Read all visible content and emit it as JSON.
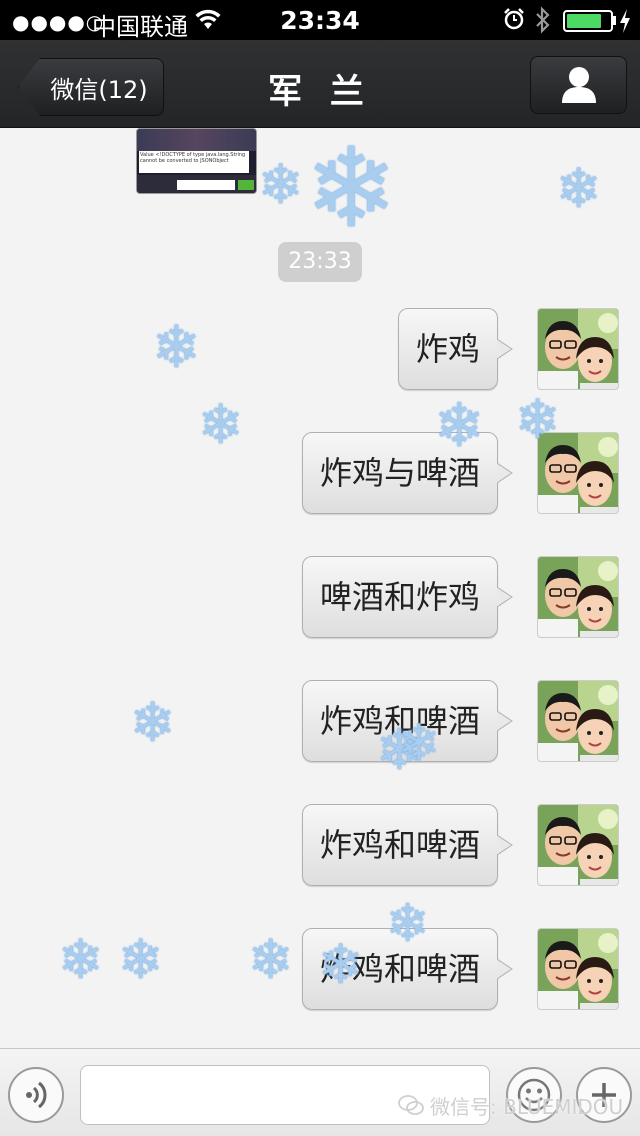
{
  "status_bar": {
    "signal": "●●●●○",
    "carrier": "中国联通",
    "time": "23:34",
    "battery_level": 0.8,
    "battery_color": "#4cd964"
  },
  "nav": {
    "back_label": "微信(12)",
    "title": "军 兰",
    "profile_icon": "person-icon"
  },
  "chat": {
    "timestamp": "23:33",
    "thumbnail_text": "Value <!DOCTYPE of type java.lang.String cannot be converted to JSONObject",
    "messages": [
      {
        "text": "炸鸡",
        "sender": "self"
      },
      {
        "text": "炸鸡与啤酒",
        "sender": "self"
      },
      {
        "text": "啤酒和炸鸡",
        "sender": "self"
      },
      {
        "text": "炸鸡和啤酒",
        "sender": "self"
      },
      {
        "text": "炸鸡和啤酒",
        "sender": "self"
      },
      {
        "text": "炸鸡和啤酒",
        "sender": "self"
      }
    ],
    "snowflake_glyph": "❄",
    "snow_color": "#a9cdef"
  },
  "input_bar": {
    "voice_icon": "voice-icon",
    "text_value": "",
    "emoji_icon": "smiley-icon",
    "plus_icon": "plus-icon"
  },
  "watermark": {
    "text": "微信号: BLUEMIDOU"
  }
}
